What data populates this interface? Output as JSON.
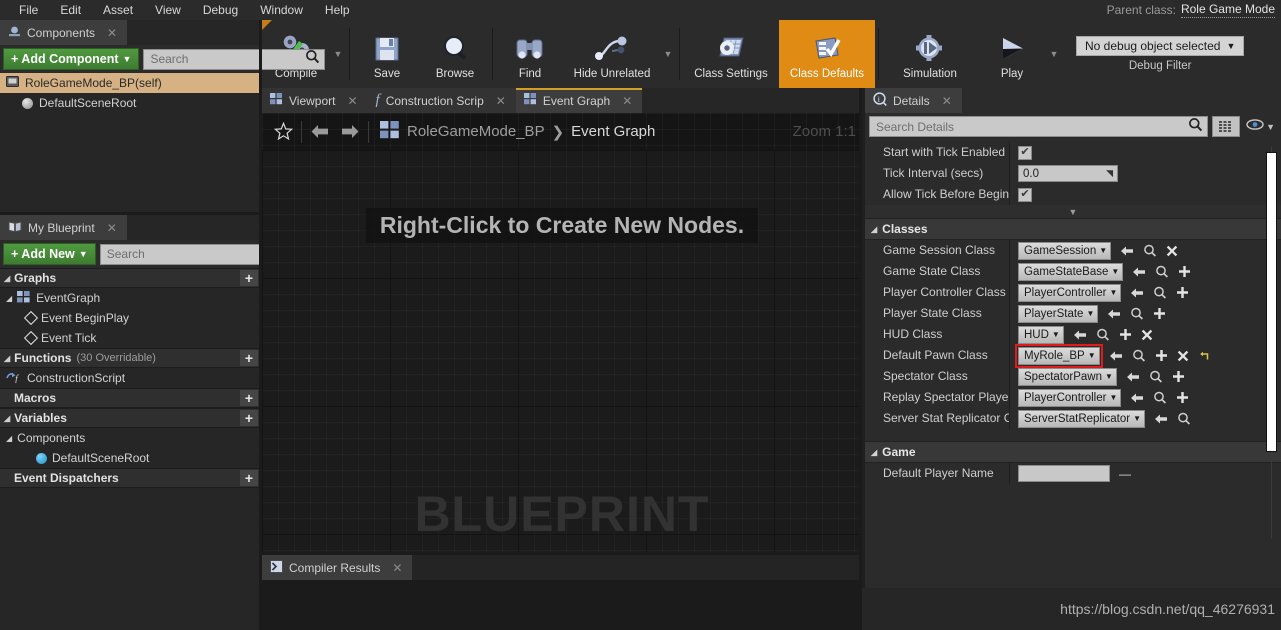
{
  "menubar": {
    "items": [
      "File",
      "Edit",
      "Asset",
      "View",
      "Debug",
      "Window",
      "Help"
    ],
    "parent_class_label": "Parent class:",
    "parent_class_value": "Role Game Mode"
  },
  "toolbar": {
    "compile": "Compile",
    "save": "Save",
    "browse": "Browse",
    "find": "Find",
    "hide_unrelated": "Hide Unrelated",
    "class_settings": "Class Settings",
    "class_defaults": "Class Defaults",
    "simulation": "Simulation",
    "play": "Play",
    "debug_object": "No debug object selected",
    "debug_filter_label": "Debug Filter",
    "active_accent": "#e08b14"
  },
  "components_panel": {
    "tab_label": "Components",
    "add_button": "+ Add Component",
    "search_placeholder": "Search",
    "search_value": "",
    "tree": [
      {
        "label": "RoleGameMode_BP(self)",
        "selected": true,
        "icon": "blueprint-self-icon"
      },
      {
        "label": "DefaultSceneRoot",
        "selected": false,
        "icon": "scene-root-icon"
      }
    ]
  },
  "my_blueprint_panel": {
    "tab_label": "My Blueprint",
    "add_button": "+ Add New",
    "search_placeholder": "Search",
    "search_value": "",
    "sections": [
      {
        "title": "Graphs",
        "sub": "",
        "add": "+",
        "rows": [
          {
            "label": "EventGraph",
            "level": 1,
            "icon": "graph-icon"
          },
          {
            "label": "Event BeginPlay",
            "level": 2,
            "icon": "event-node-icon"
          },
          {
            "label": "Event Tick",
            "level": 2,
            "icon": "event-node-icon"
          }
        ]
      },
      {
        "title": "Functions",
        "sub": "(30 Overridable)",
        "add": "+",
        "rows": [
          {
            "label": "ConstructionScript",
            "level": 1,
            "icon": "function-icon"
          }
        ]
      },
      {
        "title": "Macros",
        "sub": "",
        "add": "+",
        "rows": []
      },
      {
        "title": "Variables",
        "sub": "",
        "add": "+",
        "rows": [
          {
            "label": "Components",
            "level": 1,
            "icon": "category-icon"
          },
          {
            "label": "DefaultSceneRoot",
            "level": 3,
            "icon": "blue-sphere-icon"
          }
        ]
      },
      {
        "title": "Event Dispatchers",
        "sub": "",
        "add": "+",
        "rows": []
      }
    ]
  },
  "graph_panel": {
    "tabs": [
      {
        "label": "Viewport",
        "selected": false,
        "icon": "viewport-icon"
      },
      {
        "label": "Construction Scrip",
        "selected": false,
        "icon": "function-icon"
      },
      {
        "label": "Event Graph",
        "selected": true,
        "icon": "graph-icon"
      }
    ],
    "breadcrumb_root": "RoleGameMode_BP",
    "breadcrumb_sep": "❯",
    "breadcrumb_current": "Event Graph",
    "zoom_label": "Zoom 1:1",
    "hint": "Right-Click to Create New Nodes.",
    "watermark": "BLUEPRINT"
  },
  "compiler_panel": {
    "tab_label": "Compiler Results"
  },
  "details_panel": {
    "tab_label": "Details",
    "search_placeholder": "Search Details",
    "search_value": "",
    "top_properties": [
      {
        "label": "Start with Tick Enabled",
        "type": "checkbox",
        "checked": true
      },
      {
        "label": "Tick Interval (secs)",
        "type": "number",
        "value": "0.0"
      },
      {
        "label": "Allow Tick Before Begin",
        "type": "checkbox",
        "checked": true
      }
    ],
    "categories": [
      {
        "title": "Classes",
        "rows": [
          {
            "label": "Game Session Class",
            "value": "GameSession",
            "actions": [
              "back",
              "browse",
              "clear"
            ]
          },
          {
            "label": "Game State Class",
            "value": "GameStateBase",
            "actions": [
              "back",
              "browse",
              "add"
            ]
          },
          {
            "label": "Player Controller Class",
            "value": "PlayerController",
            "actions": [
              "back",
              "browse",
              "add"
            ]
          },
          {
            "label": "Player State Class",
            "value": "PlayerState",
            "actions": [
              "back",
              "browse",
              "add"
            ]
          },
          {
            "label": "HUD Class",
            "value": "HUD",
            "actions": [
              "back",
              "browse",
              "add",
              "clear"
            ]
          },
          {
            "label": "Default Pawn Class",
            "value": "MyRole_BP",
            "highlight": true,
            "actions": [
              "back",
              "browse",
              "add",
              "clear",
              "reset"
            ]
          },
          {
            "label": "Spectator Class",
            "value": "SpectatorPawn",
            "actions": [
              "back",
              "browse",
              "add"
            ]
          },
          {
            "label": "Replay Spectator Player",
            "value": "PlayerController",
            "actions": [
              "back",
              "browse",
              "add"
            ]
          },
          {
            "label": "Server Stat Replicator C",
            "value": "ServerStatReplicator",
            "actions": [
              "back",
              "browse"
            ]
          }
        ]
      },
      {
        "title": "Game",
        "rows": [
          {
            "label": "Default Player Name",
            "value": "",
            "actions": []
          }
        ]
      }
    ],
    "highlight_color": "#e01b1b"
  },
  "footer": {
    "url": "https://blog.csdn.net/qq_46276931"
  }
}
